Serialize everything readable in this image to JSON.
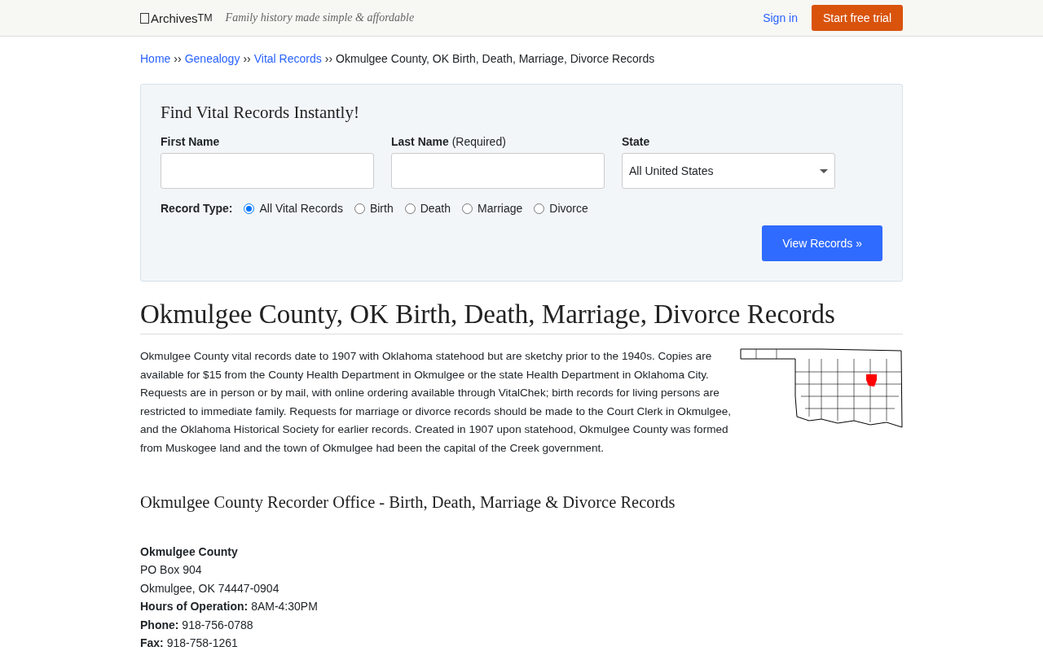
{
  "header": {
    "logo": "Archives",
    "logo_mark": "TM",
    "tagline": "Family history made simple & affordable",
    "sign_in": "Sign in",
    "cta": "Start free trial"
  },
  "breadcrumb": {
    "links": [
      "Home",
      "Genealogy",
      "Vital Records"
    ],
    "separator": "››",
    "current": "Okmulgee County, OK Birth, Death, Marriage, Divorce Records"
  },
  "search": {
    "title": "Find Vital Records Instantly!",
    "fields": [
      {
        "label": "First Name"
      },
      {
        "label": "Last Name",
        "note": "(Required)"
      }
    ],
    "state": {
      "label": "State",
      "value": "All United States"
    },
    "record_type_label": "Record Type:",
    "record_types": [
      {
        "label": "All Vital Records",
        "selected": true
      },
      {
        "label": "Birth",
        "selected": false
      },
      {
        "label": "Death",
        "selected": false
      },
      {
        "label": "Marriage",
        "selected": false
      },
      {
        "label": "Divorce",
        "selected": false
      }
    ],
    "submit": "View Records »"
  },
  "heading": "Okmulgee County, OK Birth, Death, Marriage, Divorce Records",
  "intro": "Okmulgee County vital records date to 1907 with Oklahoma statehood but are sketchy prior to the 1940s. Copies are available for $15 from the County Health Department in Okmulgee or the state Health Department in Oklahoma City. Requests are in person or by mail, with online ordering available through VitalChek; birth records for living persons are restricted to immediate family. Requests for marriage or divorce records should be made to the Court Clerk in Okmulgee, and the Oklahoma Historical Society for earlier records. Created in 1907 upon statehood, Okmulgee County was formed from Muskogee land and the town of Okmulgee had been the capital of the Creek government.",
  "office_heading": "Okmulgee County Recorder Office - Birth, Death, Marriage & Divorce Records",
  "office": {
    "name": "Okmulgee County",
    "lines": [
      "PO Box 904",
      "Okmulgee, OK 74447-0904"
    ],
    "fields": [
      {
        "label": "Hours of Operation:",
        "value": "8AM-4:30PM"
      },
      {
        "label": "Phone:",
        "value": "918-756-0788"
      },
      {
        "label": "Fax:",
        "value": "918-758-1261"
      }
    ]
  }
}
